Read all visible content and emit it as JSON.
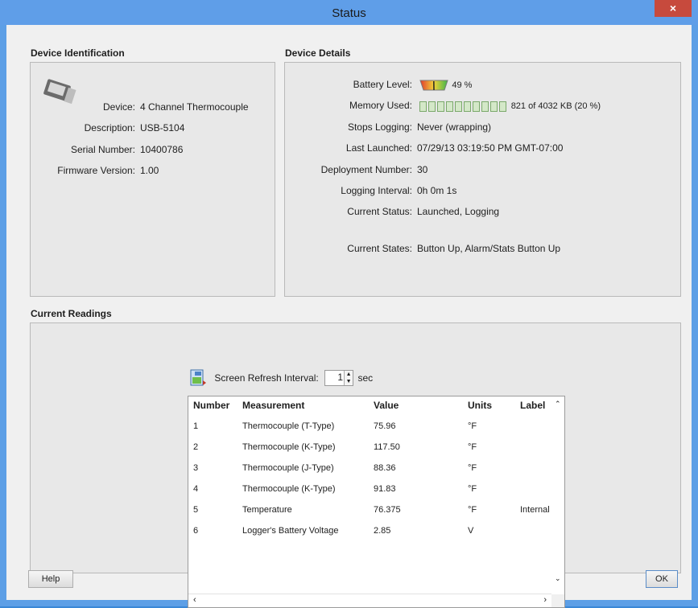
{
  "window": {
    "title": "Status",
    "close_glyph": "×"
  },
  "device_identification": {
    "section_title": "Device Identification",
    "icon": "logger-device-icon",
    "fields": [
      {
        "label": "Device:",
        "value": "4 Channel Thermocouple"
      },
      {
        "label": "Description:",
        "value": "USB-5104"
      },
      {
        "label": "Serial Number:",
        "value": "10400786"
      },
      {
        "label": "Firmware Version:",
        "value": "1.00"
      }
    ]
  },
  "device_details": {
    "section_title": "Device Details",
    "battery": {
      "label": "Battery Level:",
      "value": "49 %",
      "level_fraction": 0.49
    },
    "memory": {
      "label": "Memory Used:",
      "value": "821 of 4032 KB (20 %)",
      "used_fraction": 0.2
    },
    "fields": [
      {
        "label": "Stops Logging:",
        "value": "Never (wrapping)"
      },
      {
        "label": "Last Launched:",
        "value": "07/29/13 03:19:50 PM GMT-07:00"
      },
      {
        "label": "Deployment Number:",
        "value": "30"
      },
      {
        "label": "Logging Interval:",
        "value": "0h 0m 1s"
      },
      {
        "label": "Current Status:",
        "value": "Launched, Logging"
      }
    ],
    "states": {
      "label": "Current States:",
      "value": "Button Up, Alarm/Stats Button Up"
    }
  },
  "current_readings": {
    "section_title": "Current Readings",
    "refresh_label": "Screen Refresh Interval:",
    "refresh_value": "1",
    "refresh_unit": "sec",
    "columns": {
      "number": "Number",
      "measurement": "Measurement",
      "value": "Value",
      "units": "Units",
      "label": "Label"
    },
    "rows": [
      {
        "number": "1",
        "measurement": "Thermocouple (T-Type)",
        "value": "75.96",
        "units": "°F",
        "label": ""
      },
      {
        "number": "2",
        "measurement": "Thermocouple (K-Type)",
        "value": "117.50",
        "units": "°F",
        "label": ""
      },
      {
        "number": "3",
        "measurement": "Thermocouple (J-Type)",
        "value": "88.36",
        "units": "°F",
        "label": ""
      },
      {
        "number": "4",
        "measurement": "Thermocouple (K-Type)",
        "value": "91.83",
        "units": "°F",
        "label": ""
      },
      {
        "number": "5",
        "measurement": "Temperature",
        "value": "76.375",
        "units": "°F",
        "label": "Internal"
      },
      {
        "number": "6",
        "measurement": "Logger's Battery Voltage",
        "value": "2.85",
        "units": "V",
        "label": ""
      }
    ]
  },
  "footer": {
    "help_label": "Help",
    "ok_label": "OK"
  }
}
